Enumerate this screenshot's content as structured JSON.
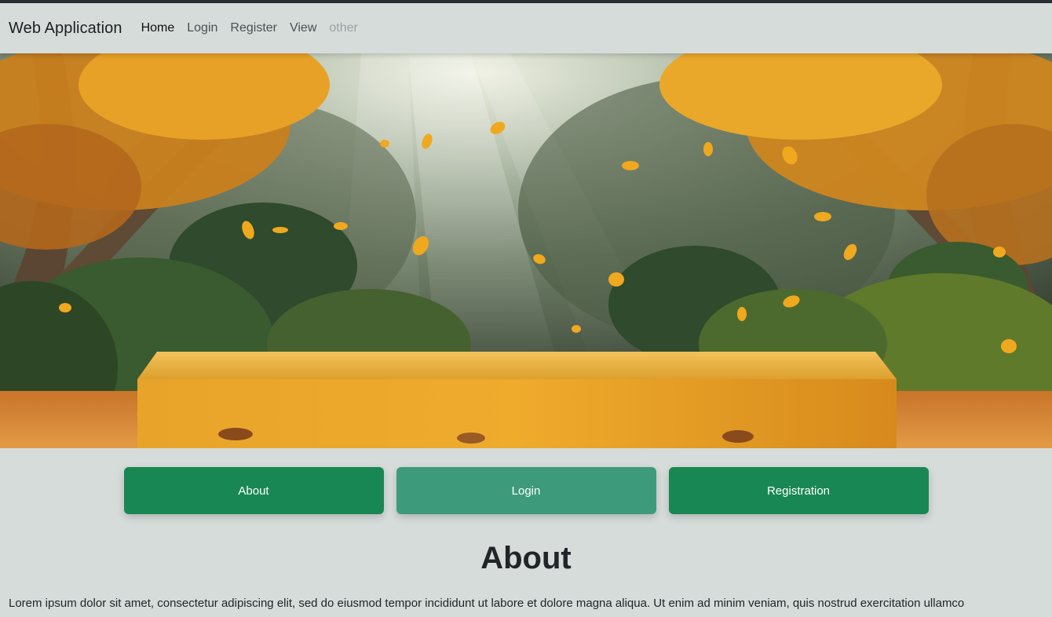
{
  "navbar": {
    "brand": "Web Application",
    "links": [
      {
        "label": "Home",
        "state": "active"
      },
      {
        "label": "Login",
        "state": "normal"
      },
      {
        "label": "Register",
        "state": "normal"
      },
      {
        "label": "View",
        "state": "normal"
      },
      {
        "label": "other",
        "state": "disabled"
      }
    ]
  },
  "hero": {
    "image": "autumn-forest-with-orange-podium"
  },
  "buttons": {
    "about": "About",
    "login": "Login",
    "registration": "Registration"
  },
  "about": {
    "title": "About",
    "text": "Lorem ipsum dolor sit amet, consectetur adipiscing elit, sed do eiusmod tempor incididunt ut labore et dolore magna aliqua. Ut enim ad minim veniam, quis nostrud exercitation ullamco"
  },
  "colors": {
    "page_bg": "#d6dcda",
    "button_green": "#198754",
    "button_green_light": "#3d9b7b"
  }
}
